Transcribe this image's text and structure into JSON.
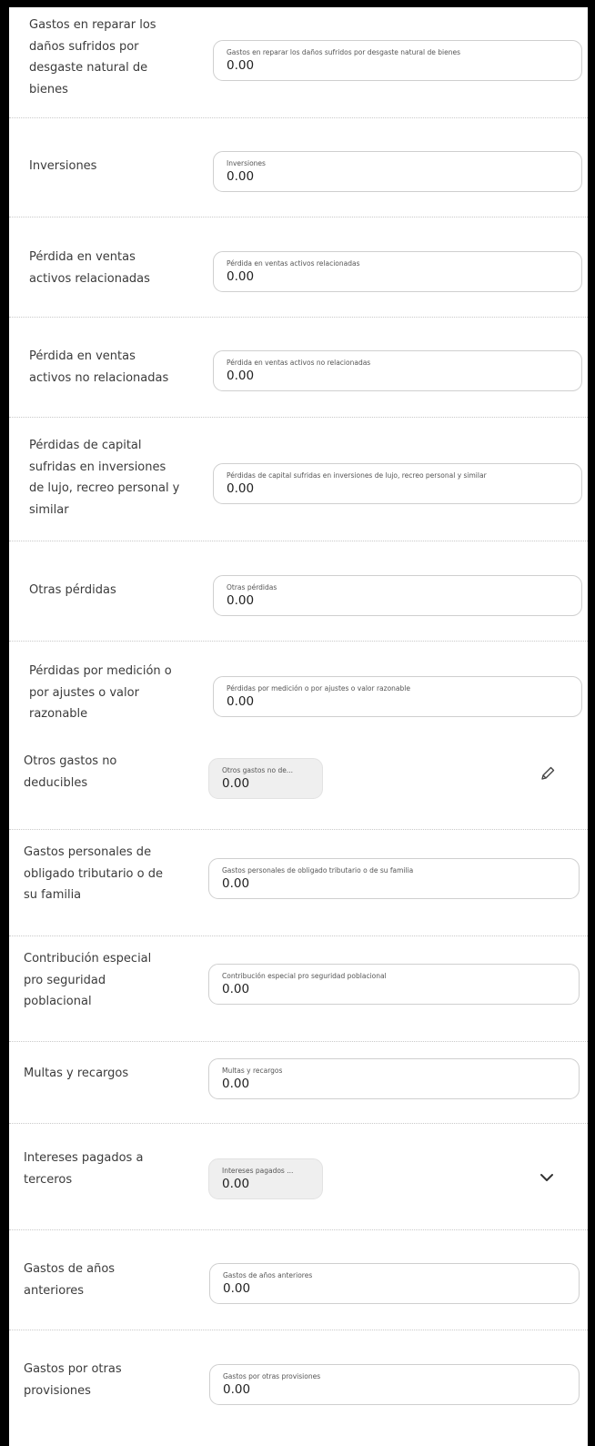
{
  "rows": [
    {
      "label": "Gastos en reparar los daños sufridos por desgaste natural de bienes",
      "field_label": "Gastos en reparar los daños sufridos por desgaste natural de bienes",
      "value": "0.00"
    },
    {
      "label": "Inversiones",
      "field_label": "Inversiones",
      "value": "0.00"
    },
    {
      "label": "Pérdida en ventas activos relacionadas",
      "field_label": "Pérdida en ventas activos relacionadas",
      "value": "0.00"
    },
    {
      "label": "Pérdida en ventas activos no relacionadas",
      "field_label": "Pérdida en ventas activos no relacionadas",
      "value": "0.00"
    },
    {
      "label": "Pérdidas de capital sufridas en inversiones de lujo, recreo personal y similar",
      "field_label": "Pérdidas de capital sufridas en inversiones de lujo, recreo personal y similar",
      "value": "0.00"
    },
    {
      "label": "Otras pérdidas",
      "field_label": "Otras pérdidas",
      "value": "0.00"
    },
    {
      "label": "Pérdidas por medición o por ajustes o valor razonable",
      "field_label": "Pérdidas por medición o por ajustes o valor razonable",
      "value": "0.00"
    },
    {
      "label": "Otros gastos no deducibles",
      "field_label": "Otros gastos no de...",
      "value": "0.00",
      "action_icon": "pencil-icon"
    },
    {
      "label": "Gastos personales de obligado tributario o de su familia",
      "field_label": "Gastos personales de obligado tributario o de su familia",
      "value": "0.00"
    },
    {
      "label": "Contribución especial pro seguridad poblacional",
      "field_label": "Contribución especial pro seguridad poblacional",
      "value": "0.00"
    },
    {
      "label": "Multas y recargos",
      "field_label": "Multas y recargos",
      "value": "0.00"
    },
    {
      "label": "Intereses pagados a terceros",
      "field_label": "Intereses pagados ...",
      "value": "0.00",
      "action_icon": "chevron-down-icon"
    },
    {
      "label": "Gastos de años anteriores",
      "field_label": "Gastos de años anteriores",
      "value": "0.00"
    },
    {
      "label": "Gastos por otras provisiones",
      "field_label": "Gastos por otras provisiones",
      "value": "0.00"
    }
  ]
}
